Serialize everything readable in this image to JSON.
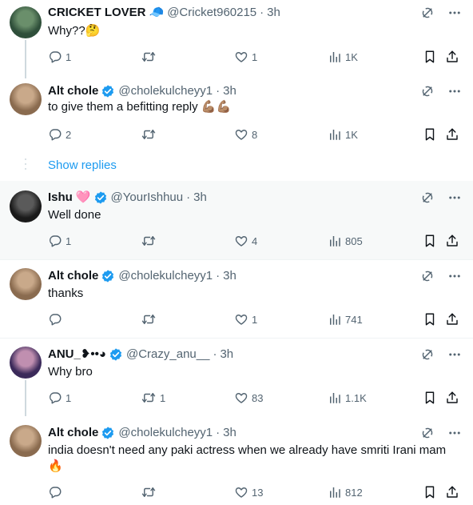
{
  "tweets": [
    {
      "name": "CRICKET LOVER",
      "handle": "@Cricket960215",
      "time": "3h",
      "text": "Why??🤔",
      "text2": "",
      "name_decor": "🧢",
      "verified": false,
      "replies": "1",
      "retweets": "",
      "likes": "1",
      "views": "1K",
      "avatar_colors": [
        "#2f4f3a",
        "#6a8f6b"
      ]
    },
    {
      "name": "Alt chole",
      "handle": "@cholekulcheyy1",
      "time": "3h",
      "text": "to give them a befitting reply 💪🏽💪🏽",
      "text2": "",
      "verified": true,
      "replies": "2",
      "retweets": "",
      "likes": "8",
      "views": "1K",
      "avatar_colors": [
        "#8a6b4f",
        "#c9a98a"
      ]
    },
    {
      "name": "Ishu",
      "handle": "@YourIshhuu",
      "time": "3h",
      "text": "Well done",
      "text2": "",
      "name_decor": "🩷",
      "verified": true,
      "replies": "1",
      "retweets": "",
      "likes": "4",
      "views": "805",
      "avatar_colors": [
        "#1a1a1a",
        "#5a5a5a"
      ]
    },
    {
      "name": "Alt chole",
      "handle": "@cholekulcheyy1",
      "time": "3h",
      "text": "thanks",
      "text2": "",
      "verified": true,
      "replies": "",
      "retweets": "",
      "likes": "1",
      "views": "741",
      "avatar_colors": [
        "#8a6b4f",
        "#c9a98a"
      ]
    },
    {
      "name": "ANU_❥••◕",
      "handle": "@Crazy_anu__",
      "time": "3h",
      "text": "Why bro",
      "text2": "",
      "verified": true,
      "replies": "1",
      "retweets": "1",
      "likes": "83",
      "views": "1.1K",
      "avatar_colors": [
        "#3b2a5a",
        "#c08fb0"
      ]
    },
    {
      "name": "Alt chole",
      "handle": "@cholekulcheyy1",
      "time": "3h",
      "text": "india doesn't need any paki actress when we already have smriti Irani mam",
      "text2": "🔥",
      "verified": true,
      "replies": "",
      "retweets": "",
      "likes": "13",
      "views": "812",
      "avatar_colors": [
        "#8a6b4f",
        "#c9a98a"
      ]
    }
  ],
  "show_replies_label": "Show replies",
  "colors": {
    "verified": "#1d9bf0",
    "link": "#1d9bf0",
    "muted": "#536471"
  },
  "icons": [
    "grok-icon",
    "more-icon",
    "reply-icon",
    "retweet-icon",
    "like-icon",
    "views-icon",
    "bookmark-icon",
    "share-icon"
  ]
}
